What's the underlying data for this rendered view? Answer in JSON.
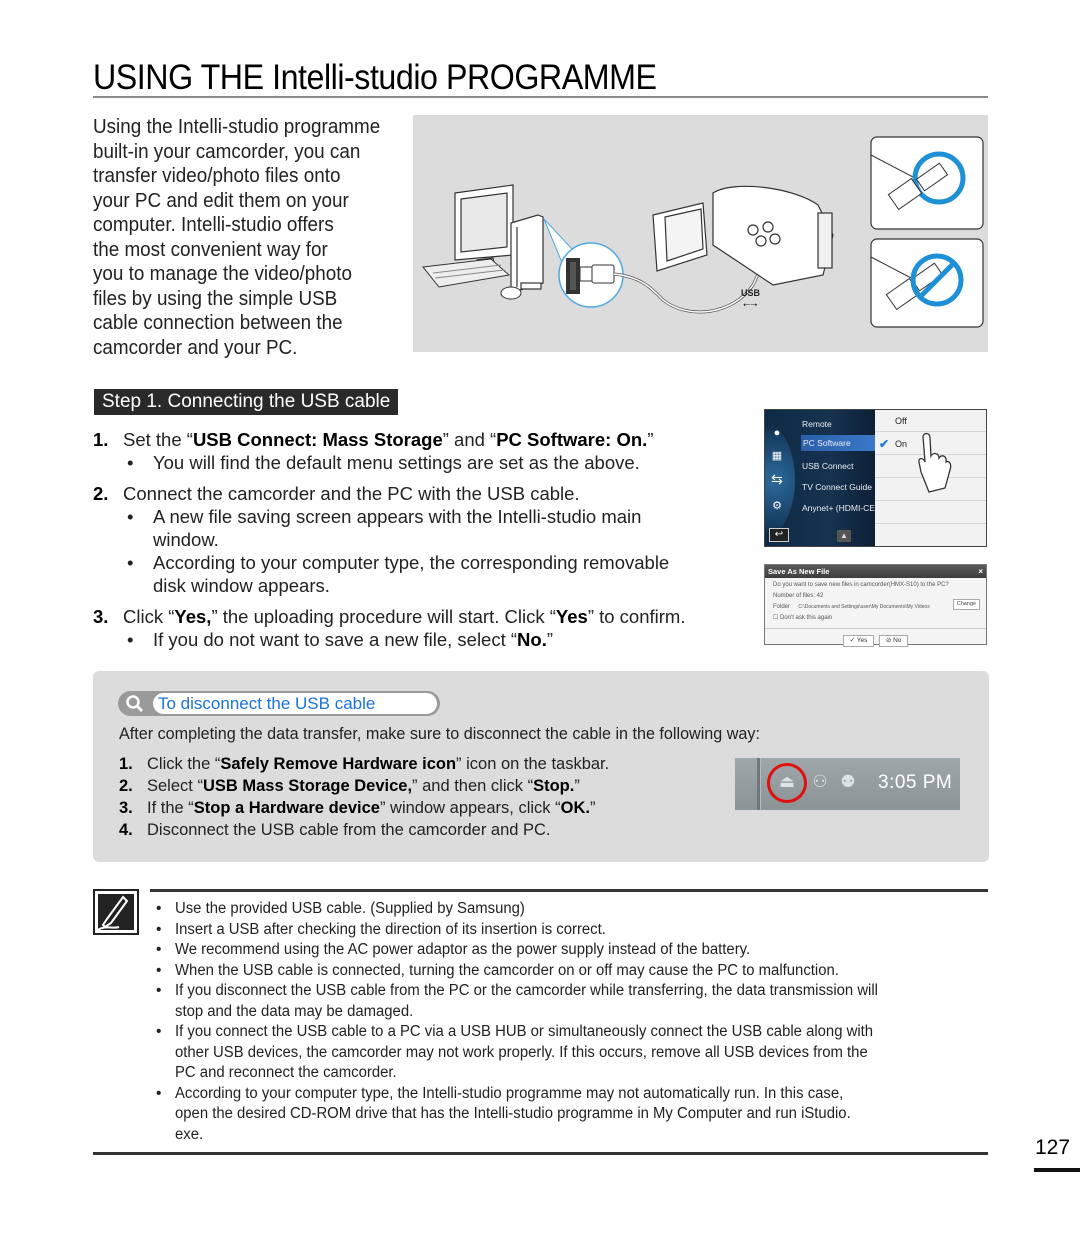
{
  "page": {
    "title": "USING THE Intelli-studio PROGRAMME",
    "page_number": "127"
  },
  "intro": {
    "lines": [
      "Using the Intelli-studio programme",
      "built-in your camcorder, you can",
      "transfer video/photo files onto",
      "your PC and edit them on your",
      "computer. Intelli-studio offers",
      "the most convenient way for",
      "you to manage the video/photo",
      "files by using the simple USB",
      "cable connection between the",
      "camcorder and your PC."
    ]
  },
  "illustration": {
    "usb_label": "USB",
    "accent_color": "#1e90d6"
  },
  "step1": {
    "header": "Step 1. Connecting the USB cable",
    "items": [
      {
        "num": "1.",
        "parts": [
          "Set the “",
          "USB Connect: Mass Storage",
          "” and “",
          "PC Software: On.",
          "”"
        ],
        "bullets": [
          "You will find the default menu settings are set as the above."
        ]
      },
      {
        "num": "2.",
        "text": "Connect the camcorder and the PC with the USB cable.",
        "bullets": [
          "A new file saving screen appears with the Intelli-studio main",
          "window.",
          "According to your computer type, the corresponding removable",
          "disk window appears."
        ]
      },
      {
        "num": "3.",
        "parts": [
          "Click “",
          "Yes,",
          "” the uploading procedure will start. Click “",
          "Yes",
          "” to confirm."
        ],
        "bullets_parts": [
          [
            "If you do not want to save a new file, select “",
            "No.",
            "”"
          ]
        ]
      }
    ],
    "bullet_char": "•"
  },
  "camcorder_menu": {
    "items": [
      "Remote",
      "PC Software",
      "USB Connect",
      "TV Connect Guide",
      "Anynet+ (HDMI-CEC)"
    ],
    "selected_item": "PC Software",
    "options": [
      "Off",
      "On"
    ],
    "selected_option": "On",
    "check": "✔",
    "page_indicator": "1"
  },
  "save_dialog": {
    "title": "Save As New File",
    "close": "×",
    "question": "Do you want to save new files in camcorder(HMX-S10) to the PC?",
    "line2": "Number of files: 42",
    "folder_label": "Folder",
    "folder_path": "C:\\Documents and Settings\\user\\My Documents\\My Videos",
    "change_button": "Change",
    "checkbox_label": "Don't ask this again",
    "yes_button": "Yes",
    "no_button": "No"
  },
  "disconnect": {
    "title": "To disconnect the USB cable",
    "intro": "After completing the data transfer, make sure to disconnect the cable in the following way:",
    "steps": [
      {
        "num": "1.",
        "parts": [
          "Click the “",
          "Safely Remove Hardware icon",
          "” icon on the taskbar."
        ]
      },
      {
        "num": "2.",
        "parts": [
          "Select “",
          "USB Mass Storage Device,",
          "” and then click “",
          "Stop.",
          "”"
        ]
      },
      {
        "num": "3.",
        "parts": [
          "If the “",
          "Stop a Hardware device",
          "” window appears, click “",
          "OK.",
          "”"
        ]
      },
      {
        "num": "4.",
        "parts": [
          "Disconnect the USB cable from the camcorder and PC."
        ]
      }
    ],
    "taskbar_time": "3:05 PM",
    "highlight_color": "#e01010",
    "title_color": "#1a73d9"
  },
  "notes": {
    "bullet_char": "•",
    "items": [
      [
        "Use the provided USB cable. (Supplied by Samsung)"
      ],
      [
        "Insert a USB after checking the direction of its insertion is correct."
      ],
      [
        "We recommend using the AC power adaptor as the power supply instead of the battery."
      ],
      [
        "When the USB cable is connected, turning the camcorder on or off may cause the PC to malfunction."
      ],
      [
        "If you disconnect the USB cable from the PC or the camcorder while transferring, the data transmission will",
        "stop and the data may be damaged."
      ],
      [
        "If you connect the USB cable to a PC via a USB HUB or simultaneously connect the USB cable along with",
        "other USB devices, the camcorder may not work properly. If this occurs, remove all USB devices from the",
        "PC and reconnect the camcorder."
      ],
      [
        "According to your computer type, the Intelli-studio programme may not automatically run. In this case,",
        "open the desired CD-ROM drive that has the Intelli-studio programme in My Computer and run iStudio.",
        "exe."
      ]
    ]
  }
}
